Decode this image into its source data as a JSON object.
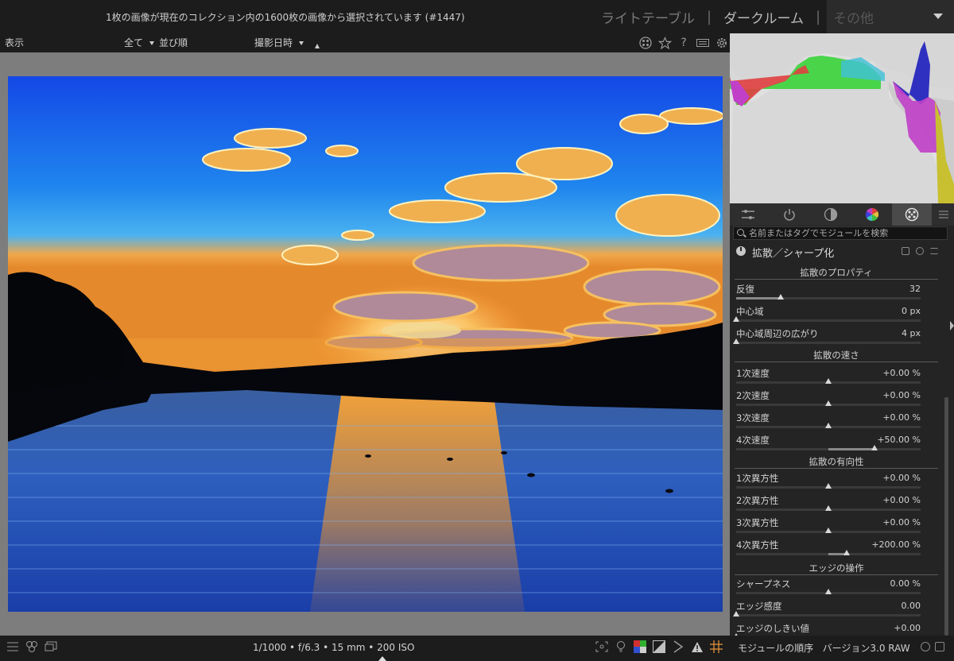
{
  "header": {
    "collection_info": "1枚の画像が現在のコレクション内の1600枚の画像から選択されています (#1447)",
    "views": [
      {
        "label": "ライトテーブル",
        "active": false
      },
      {
        "label": "ダークルーム",
        "active": true
      }
    ],
    "other_view": "その他"
  },
  "filterbar": {
    "display_label": "表示",
    "filter_value": "全て",
    "sort_label": "並び順",
    "sort_value": "撮影日時"
  },
  "header_icons": [
    "grouping-icon",
    "star-icon",
    "help-icon",
    "keyboard-icon",
    "gear-icon"
  ],
  "module_tabs": [
    {
      "name": "basic-adjust-icon",
      "active": false
    },
    {
      "name": "power-icon",
      "active": false
    },
    {
      "name": "tone-icon",
      "active": false
    },
    {
      "name": "color-icon",
      "active": false
    },
    {
      "name": "effects-icon",
      "active": true
    }
  ],
  "search": {
    "placeholder": "名前またはタグでモジュールを検索"
  },
  "module": {
    "name": "拡散／シャープ化",
    "sections": {
      "properties": "拡散のプロパティ",
      "speed": "拡散の速さ",
      "direction": "拡散の有向性",
      "edges": "エッジの操作"
    },
    "sliders": [
      {
        "label": "反復",
        "value": "32",
        "level": 0.24
      },
      {
        "label": "中心域",
        "value": "0 px",
        "level": 0.0
      },
      {
        "label": "中心域周辺の広がり",
        "value": "4 px",
        "level": 0.0
      },
      {
        "label": "1次速度",
        "value": "+0.00 %",
        "level": 0.5
      },
      {
        "label": "2次速度",
        "value": "+0.00 %",
        "level": 0.5
      },
      {
        "label": "3次速度",
        "value": "+0.00 %",
        "level": 0.5
      },
      {
        "label": "4次速度",
        "value": "+50.00 %",
        "level": 0.75
      },
      {
        "label": "1次異方性",
        "value": "+0.00 %",
        "level": 0.5
      },
      {
        "label": "2次異方性",
        "value": "+0.00 %",
        "level": 0.5
      },
      {
        "label": "3次異方性",
        "value": "+0.00 %",
        "level": 0.5
      },
      {
        "label": "4次異方性",
        "value": "+200.00 %",
        "level": 0.6
      },
      {
        "label": "シャープネス",
        "value": "0.00 %",
        "level": 0.5
      },
      {
        "label": "エッジ感度",
        "value": "0.00",
        "level": 0.0
      },
      {
        "label": "エッジのしきい値",
        "value": "+0.00",
        "level": 0.0
      }
    ]
  },
  "bottombar": {
    "exif": "1/1000 • f/6.3 • 15 mm • 200 ISO",
    "left_icons": [
      "list-icon",
      "styles-icon",
      "display-icon"
    ],
    "right_icons": [
      "focus-peaking-icon",
      "bulb-icon",
      "softproof-icon",
      "overexposure-icon",
      "guides-icon",
      "gamut-warning-icon",
      "grid-icon"
    ]
  },
  "module_footer": {
    "order_label": "モジュールの順序",
    "version_label": "バージョン3.0 RAW"
  }
}
